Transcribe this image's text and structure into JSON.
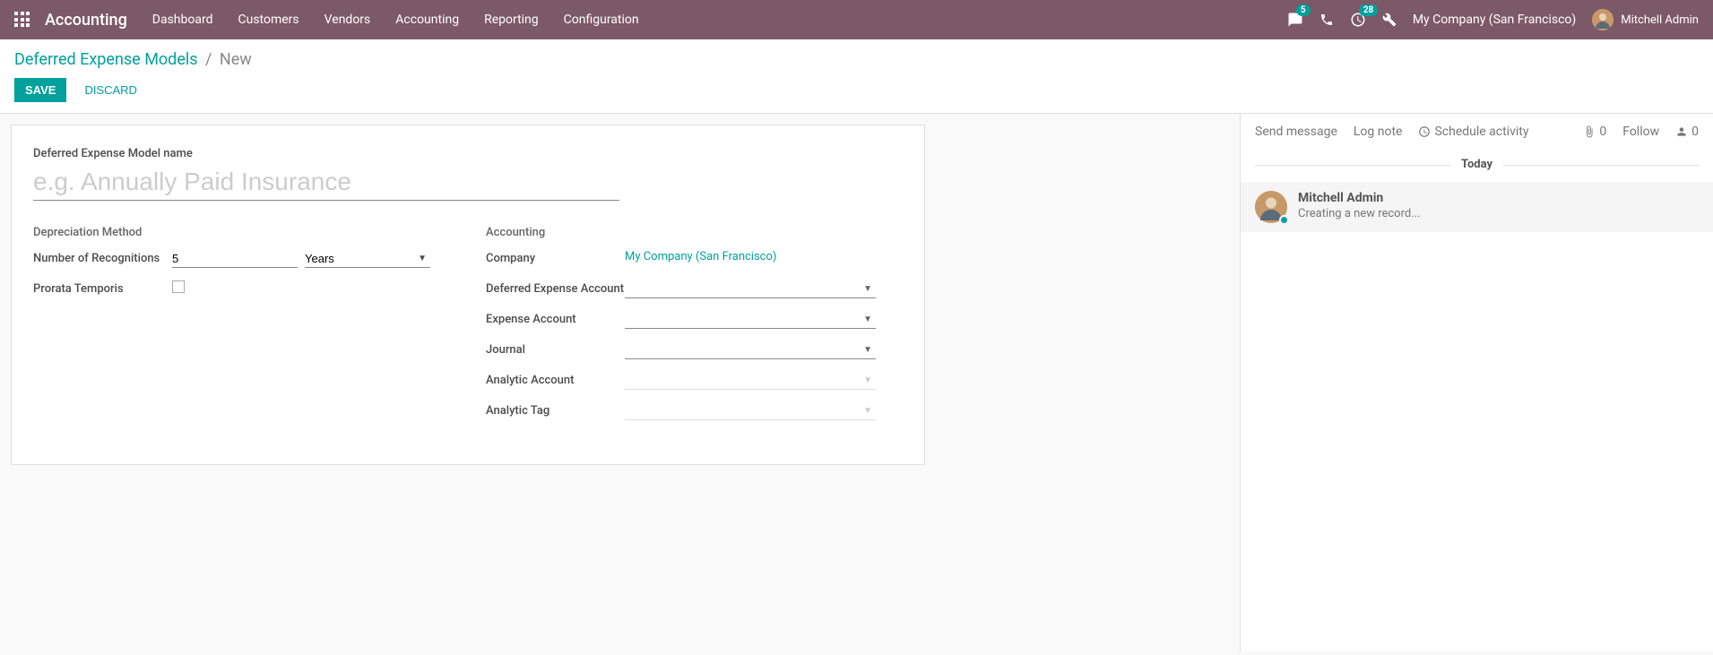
{
  "navbar": {
    "brand": "Accounting",
    "menu": [
      "Dashboard",
      "Customers",
      "Vendors",
      "Accounting",
      "Reporting",
      "Configuration"
    ],
    "messages_count": "5",
    "activities_count": "28",
    "company": "My Company (San Francisco)",
    "user": "Mitchell Admin"
  },
  "breadcrumb": {
    "parent": "Deferred Expense Models",
    "current": "New"
  },
  "buttons": {
    "save": "SAVE",
    "discard": "DISCARD"
  },
  "form": {
    "name_label": "Deferred Expense Model name",
    "name_placeholder": "e.g. Annually Paid Insurance",
    "left": {
      "title": "Depreciation Method",
      "num_recog_label": "Number of Recognitions",
      "num_recog_value": "5",
      "num_recog_unit": "Years",
      "prorata_label": "Prorata Temporis"
    },
    "right": {
      "title": "Accounting",
      "company_label": "Company",
      "company_value": "My Company (San Francisco)",
      "deferred_account_label": "Deferred Expense Account",
      "expense_account_label": "Expense Account",
      "journal_label": "Journal",
      "analytic_account_label": "Analytic Account",
      "analytic_tag_label": "Analytic Tag"
    }
  },
  "chatter": {
    "send_message": "Send message",
    "log_note": "Log note",
    "schedule_activity": "Schedule activity",
    "attachments": "0",
    "follow": "Follow",
    "followers": "0",
    "day": "Today",
    "message": {
      "author": "Mitchell Admin",
      "body": "Creating a new record..."
    }
  }
}
